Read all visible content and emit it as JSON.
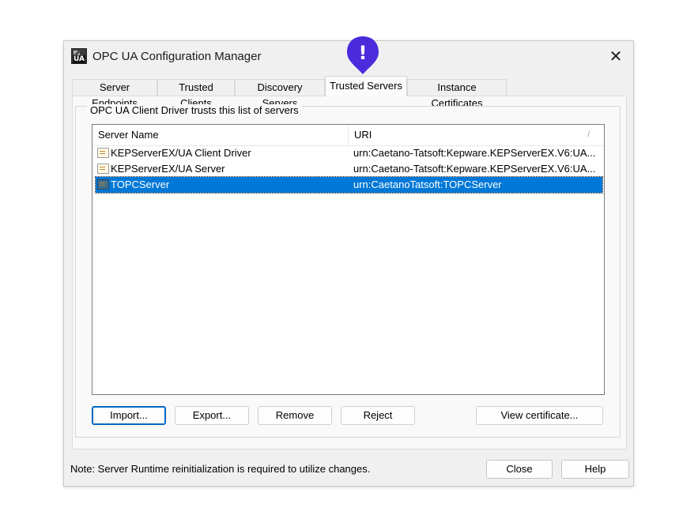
{
  "window": {
    "title": "OPC UA Configuration Manager",
    "icon_label": "UA"
  },
  "tabs": [
    {
      "label": "Server Endpoints"
    },
    {
      "label": "Trusted Clients"
    },
    {
      "label": "Discovery Servers"
    },
    {
      "label": "Trusted Servers",
      "active": true
    },
    {
      "label": "Instance Certificates"
    }
  ],
  "group": {
    "legend": "OPC UA Client Driver trusts this list of servers"
  },
  "list": {
    "columns": [
      "Server Name",
      "URI"
    ],
    "rows": [
      {
        "name": "KEPServerEX/UA Client Driver",
        "uri": "urn:Caetano-Tatsoft:Kepware.KEPServerEX.V6:UA..."
      },
      {
        "name": "KEPServerEX/UA Server",
        "uri": "urn:Caetano-Tatsoft:Kepware.KEPServerEX.V6:UA..."
      },
      {
        "name": "TOPCServer",
        "uri": "urn:CaetanoTatsoft:TOPCServer",
        "selected": true
      }
    ]
  },
  "buttons": {
    "import": "Import...",
    "export": "Export...",
    "remove": "Remove",
    "reject": "Reject",
    "view_certificate": "View certificate...",
    "close": "Close",
    "help": "Help"
  },
  "footer": {
    "note": "Note: Server Runtime reinitialization is required to utilize changes."
  },
  "badge": {
    "glyph": "!",
    "color": "#4b2bdc"
  }
}
